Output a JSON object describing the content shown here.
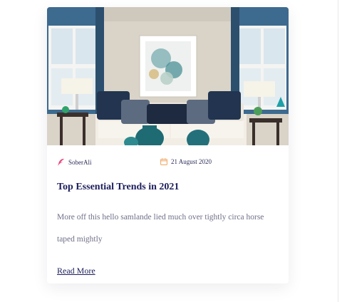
{
  "card": {
    "image_alt": "Living room with sofa, cushions, abstract wall art and lamps",
    "author": "SoberAli",
    "author_icon": "feather-icon",
    "date": "21 August 2020",
    "date_icon": "calendar-icon",
    "title": "Top Essential Trends in 2021",
    "excerpt": "More off this hello samlande lied much over tightly circa horse taped mightly",
    "read_more": "Read More"
  },
  "colors": {
    "title": "#1c1e5c",
    "body_text": "#6f7088",
    "author_icon": "#e8437a",
    "date_icon": "#f0a05a"
  }
}
